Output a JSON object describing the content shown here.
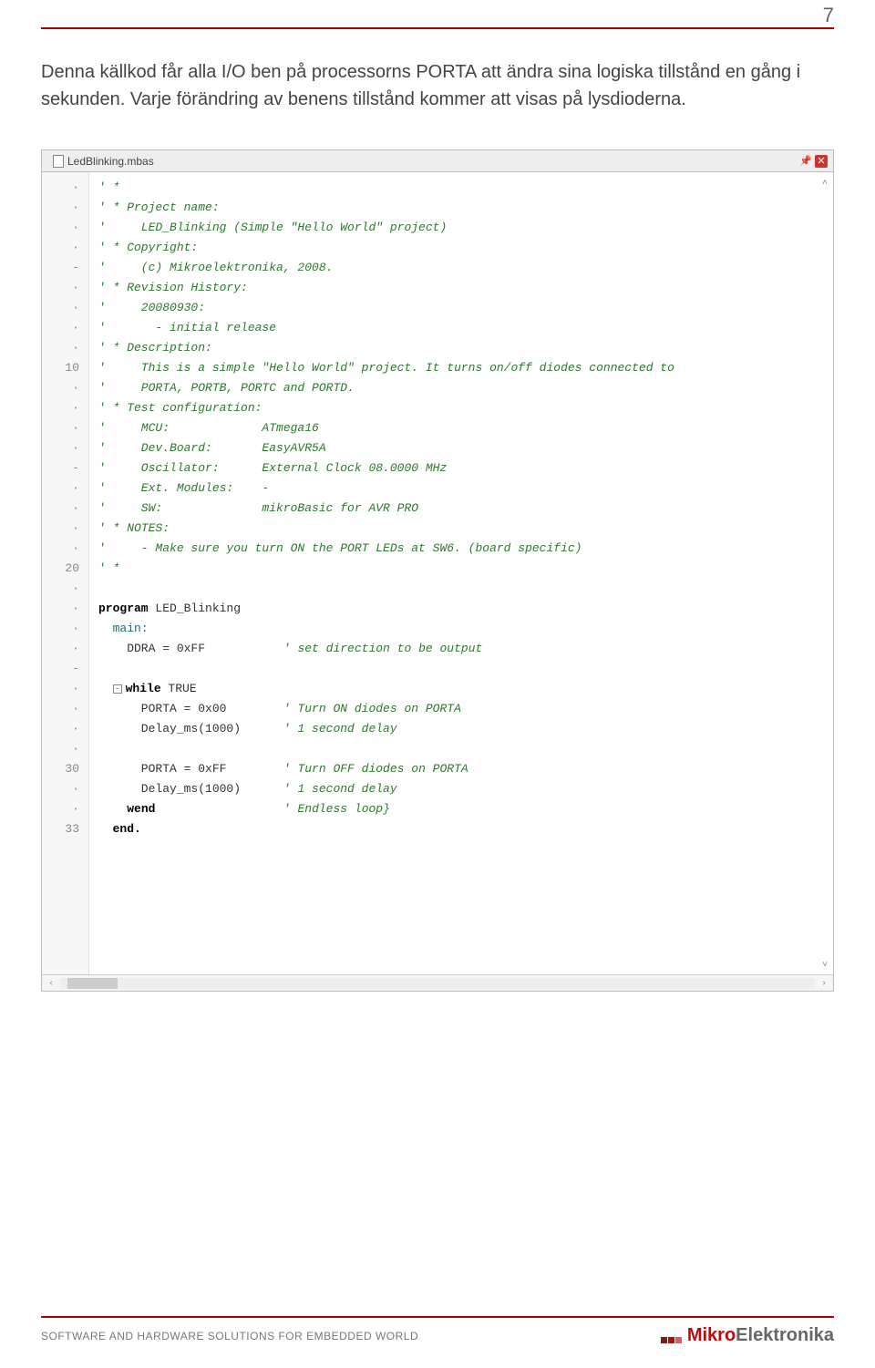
{
  "page": {
    "number": "7",
    "intro": "Denna källkod får alla I/O ben på processorns PORTA att ändra sina logiska tillstånd en gång i sekunden. Varje förändring av benens tillstånd kommer att visas på lysdioderna."
  },
  "editor": {
    "tab_filename": "LedBlinking.mbas",
    "gutter": [
      "·",
      "·",
      "·",
      "·",
      "-",
      "·",
      "·",
      "·",
      "·",
      "10",
      "·",
      "·",
      "·",
      "·",
      "-",
      "·",
      "·",
      "·",
      "·",
      "20",
      "·",
      "·",
      "·",
      "·",
      "-",
      "·",
      "·",
      "·",
      "·",
      "30",
      "·",
      "·",
      "33"
    ],
    "lines": [
      {
        "kind": "comment",
        "text": "' *"
      },
      {
        "kind": "comment",
        "text": "' * Project name:"
      },
      {
        "kind": "comment",
        "text": "'     LED_Blinking (Simple \"Hello World\" project)"
      },
      {
        "kind": "comment",
        "text": "' * Copyright:"
      },
      {
        "kind": "comment",
        "text": "'     (c) Mikroelektronika, 2008."
      },
      {
        "kind": "comment",
        "text": "' * Revision History:"
      },
      {
        "kind": "comment",
        "text": "'     20080930:"
      },
      {
        "kind": "comment",
        "text": "'       - initial release"
      },
      {
        "kind": "comment",
        "text": "' * Description:"
      },
      {
        "kind": "comment",
        "text": "'     This is a simple \"Hello World\" project. It turns on/off diodes connected to"
      },
      {
        "kind": "comment",
        "text": "'     PORTA, PORTB, PORTC and PORTD."
      },
      {
        "kind": "comment",
        "text": "' * Test configuration:"
      },
      {
        "kind": "comment",
        "text": "'     MCU:             ATmega16"
      },
      {
        "kind": "comment",
        "text": "'     Dev.Board:       EasyAVR5A"
      },
      {
        "kind": "comment",
        "text": "'     Oscillator:      External Clock 08.0000 MHz"
      },
      {
        "kind": "comment",
        "text": "'     Ext. Modules:    -"
      },
      {
        "kind": "comment",
        "text": "'     SW:              mikroBasic for AVR PRO"
      },
      {
        "kind": "comment",
        "text": "' * NOTES:"
      },
      {
        "kind": "comment",
        "text": "'     - Make sure you turn ON the PORT LEDs at SW6. (board specific)"
      },
      {
        "kind": "comment",
        "text": "' *"
      },
      {
        "kind": "blank",
        "text": ""
      },
      {
        "kind": "program",
        "kw": "program",
        "text": " LED_Blinking"
      },
      {
        "kind": "teal",
        "text": "  main:"
      },
      {
        "kind": "code",
        "pre": "    DDRA = 0xFF           ",
        "comment": "' set direction to be output"
      },
      {
        "kind": "blank",
        "text": ""
      },
      {
        "kind": "while",
        "fold": true,
        "kw": "while",
        "tail": " TRUE"
      },
      {
        "kind": "code",
        "pre": "      PORTA = 0x00        ",
        "comment": "' Turn ON diodes on PORTA"
      },
      {
        "kind": "code",
        "pre": "      Delay_ms(1000)      ",
        "comment": "' 1 second delay"
      },
      {
        "kind": "blank",
        "text": ""
      },
      {
        "kind": "code",
        "pre": "      PORTA = 0xFF        ",
        "comment": "' Turn OFF diodes on PORTA"
      },
      {
        "kind": "code",
        "pre": "      Delay_ms(1000)      ",
        "comment": "' 1 second delay"
      },
      {
        "kind": "wend",
        "kw": "wend",
        "comment": "' Endless loop}"
      },
      {
        "kind": "end",
        "kw": "end."
      }
    ]
  },
  "footer": {
    "text": "SOFTWARE AND HARDWARE SOLUTIONS FOR EMBEDDED WORLD",
    "brand_red": "Mikro",
    "brand_gray": "Elektronika"
  }
}
